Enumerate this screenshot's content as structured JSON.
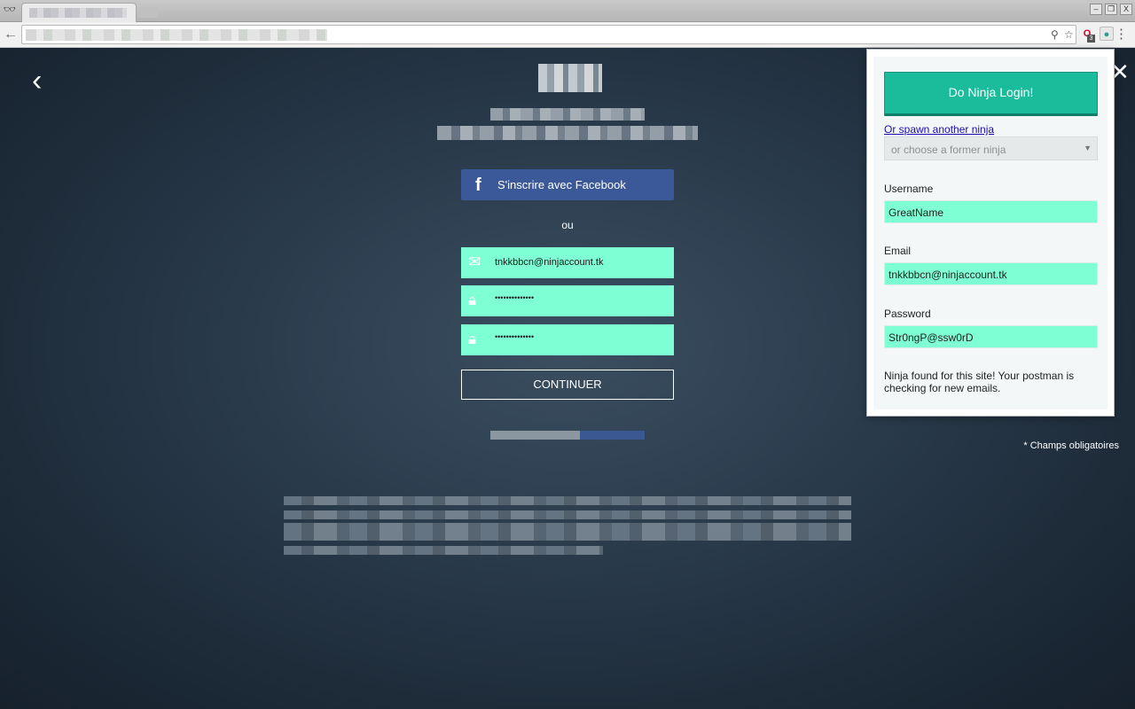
{
  "browser": {
    "controls": {
      "minimize": "–",
      "restore": "❐",
      "close": "X"
    },
    "extension_badge": "3"
  },
  "page": {
    "facebook_button": "S'inscrire avec Facebook",
    "separator": "ou",
    "email_value": "tnkkbbcn@ninjaccount.tk",
    "password_value": "••••••••••••••",
    "password_confirm_value": "••••••••••••••",
    "continue_label": "CONTINUER",
    "required_note": "* Champs obligatoires"
  },
  "popup": {
    "login_button": "Do Ninja Login!",
    "spawn_link": "Or spawn another ninja",
    "former_select_placeholder": "or choose a former ninja",
    "username_label": "Username",
    "username_value": "GreatName",
    "email_label": "Email",
    "email_value": "tnkkbbcn@ninjaccount.tk",
    "password_label": "Password",
    "password_value": "Str0ngP@ssw0rD",
    "status_message": "Ninja found for this site! Your postman is checking for new emails."
  },
  "colors": {
    "field_bg": "#7fffd4",
    "facebook_blue": "#3b5998",
    "ninja_green": "#1abc9c",
    "link_blue": "#1a0dab"
  }
}
